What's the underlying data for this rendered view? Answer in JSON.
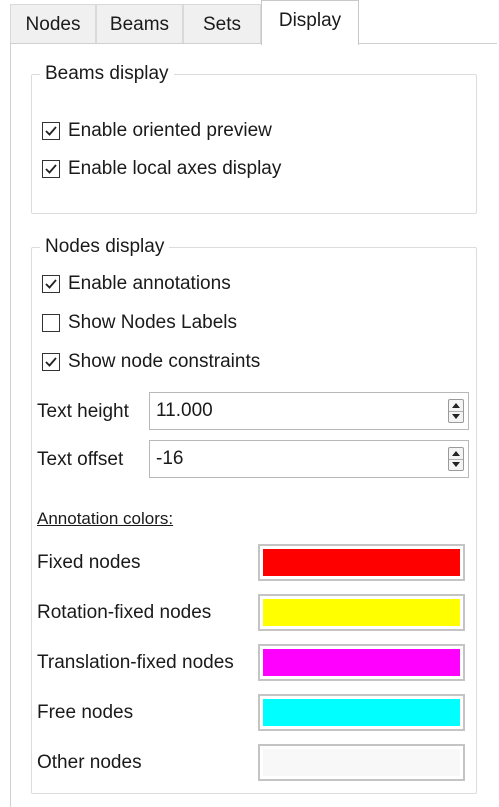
{
  "tabs": [
    {
      "label": "Nodes"
    },
    {
      "label": "Beams"
    },
    {
      "label": "Sets"
    },
    {
      "label": "Display"
    }
  ],
  "beams_display": {
    "title": "Beams display",
    "options": [
      {
        "label": "Enable oriented preview",
        "checked": true
      },
      {
        "label": "Enable local axes display",
        "checked": true
      }
    ]
  },
  "nodes_display": {
    "title": "Nodes display",
    "options": [
      {
        "label": "Enable annotations",
        "checked": true
      },
      {
        "label": "Show Nodes Labels",
        "checked": false
      },
      {
        "label": "Show node constraints",
        "checked": true
      }
    ],
    "text_height": {
      "label": "Text height",
      "value": "11.000"
    },
    "text_offset": {
      "label": "Text offset",
      "value": "-16"
    },
    "annotation_colors_heading": "Annotation colors:",
    "colors": [
      {
        "label": "Fixed nodes",
        "color": "#ff0000"
      },
      {
        "label": "Rotation-fixed nodes",
        "color": "#ffff00"
      },
      {
        "label": "Translation-fixed nodes",
        "color": "#ff00ff"
      },
      {
        "label": "Free nodes",
        "color": "#00ffff"
      },
      {
        "label": "Other nodes",
        "color": "#f8f8f8"
      }
    ]
  }
}
